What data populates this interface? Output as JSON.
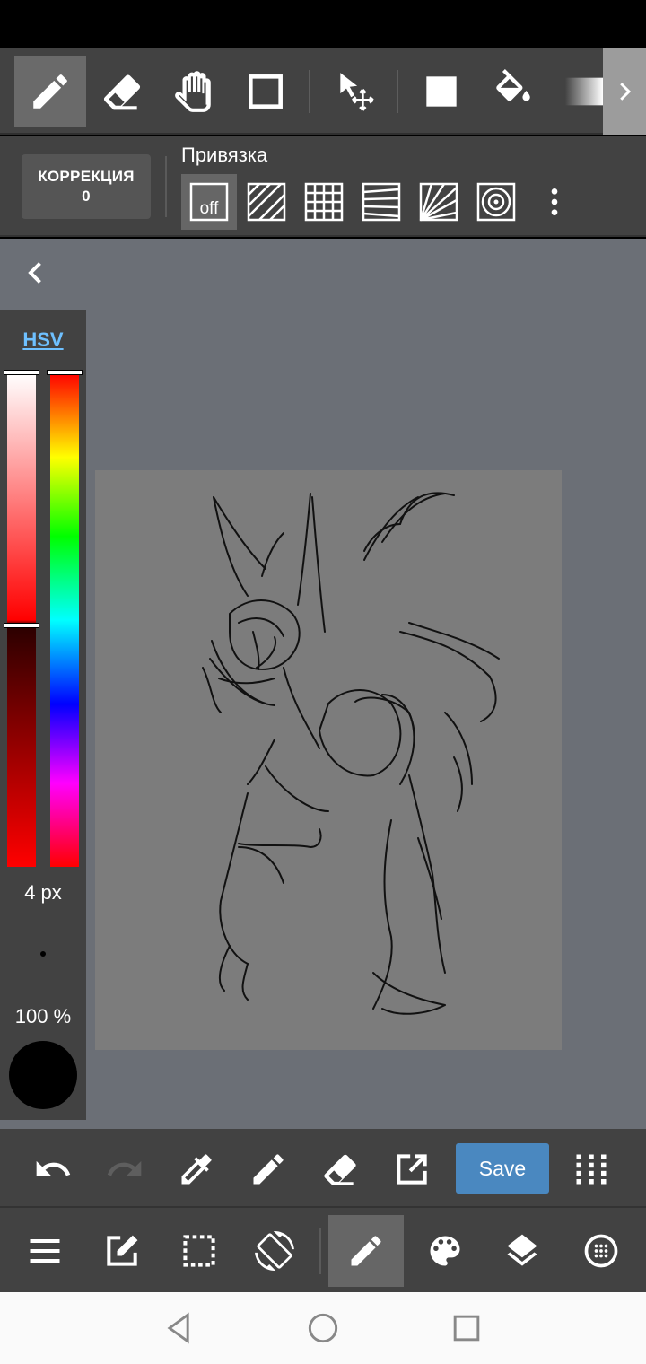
{
  "toolbar": {
    "tools": [
      {
        "name": "pen-tool",
        "icon": "pencil-icon",
        "active": true
      },
      {
        "name": "eraser-tool",
        "icon": "eraser-icon"
      },
      {
        "name": "hand-tool",
        "icon": "hand-icon"
      },
      {
        "name": "select-rect-tool",
        "icon": "rectangle-icon"
      },
      {
        "name": "move-tool",
        "icon": "move-cursor-icon"
      },
      {
        "name": "fill-rect-tool",
        "icon": "filled-square-icon"
      },
      {
        "name": "bucket-tool",
        "icon": "paint-bucket-icon"
      },
      {
        "name": "gradient-tool",
        "icon": "gradient-icon"
      }
    ]
  },
  "correction": {
    "label": "КОРРЕКЦИЯ",
    "value": "0"
  },
  "snap": {
    "label": "Привязка",
    "off_label": "off",
    "options": [
      "off",
      "parallel",
      "grid",
      "perspective",
      "radial",
      "circle"
    ]
  },
  "palette": {
    "mode_label": "HSV",
    "brush_size": "4 px",
    "opacity": "100 %",
    "current_color": "#000000"
  },
  "actions": {
    "save_label": "Save"
  },
  "colors": {
    "toolbar_bg": "#424242",
    "workspace_bg": "#6b6f76",
    "canvas_bg": "#7c7c7c",
    "save_bg": "#4a88c0",
    "hsv_link": "#6ec0ff"
  }
}
